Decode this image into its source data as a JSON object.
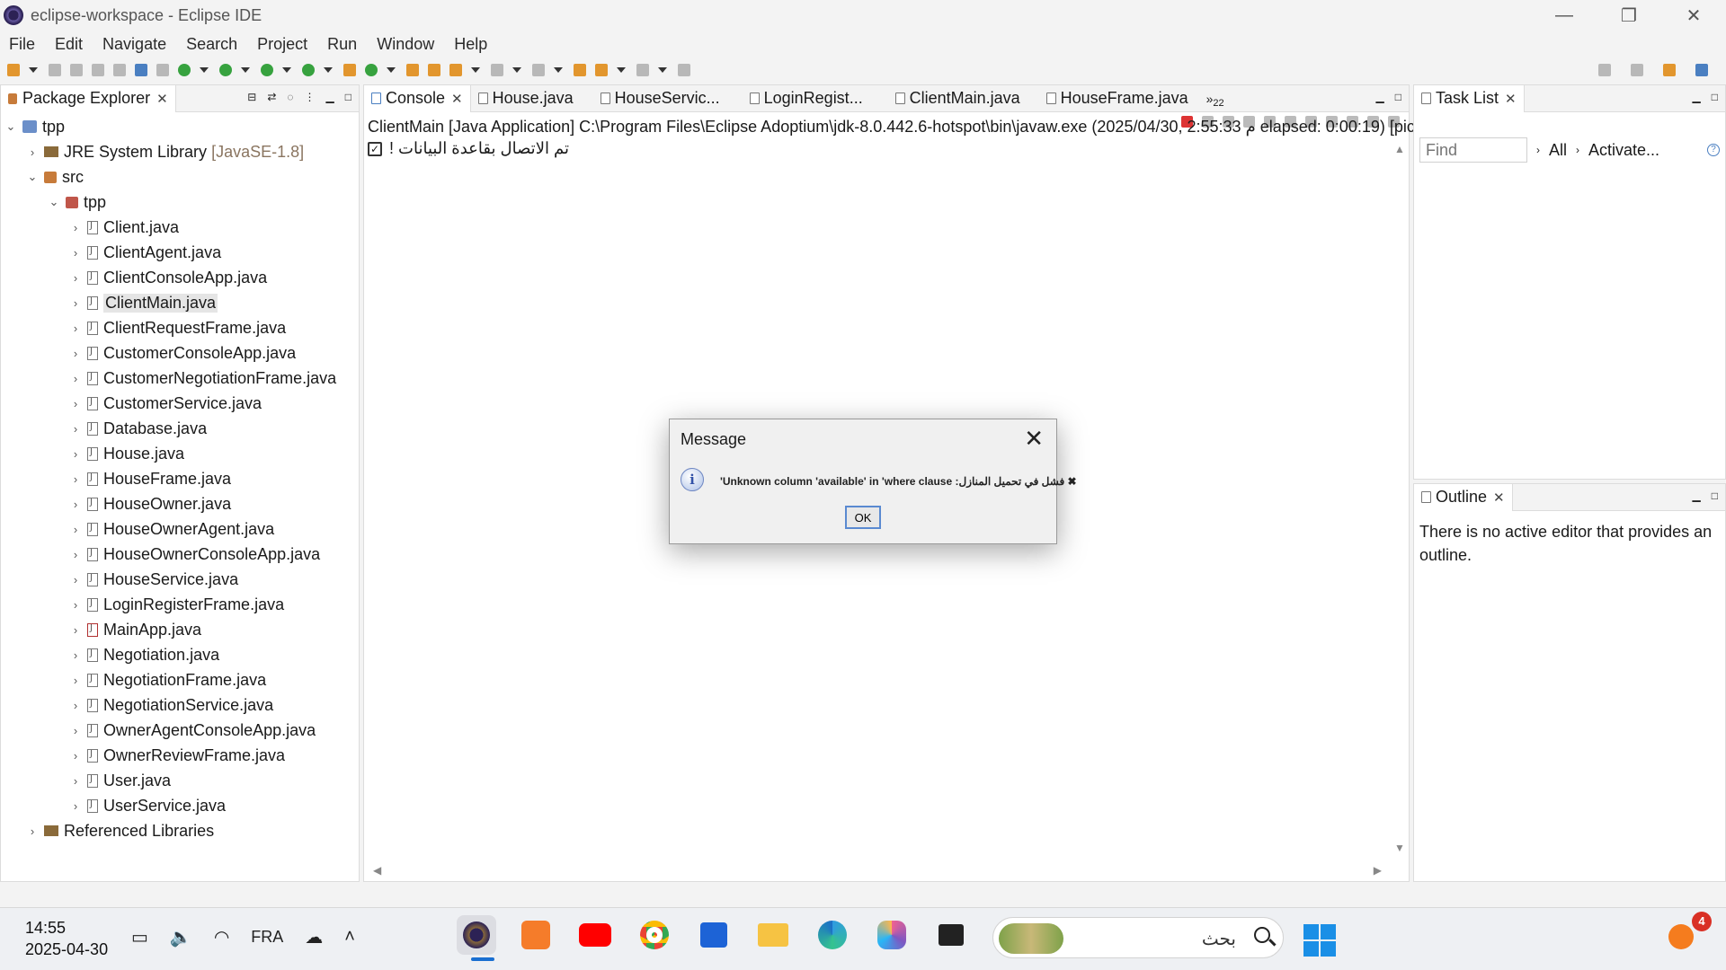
{
  "window": {
    "title": "eclipse-workspace - Eclipse IDE",
    "controls": [
      "—",
      "❐",
      "✕"
    ]
  },
  "menu": [
    "File",
    "Edit",
    "Navigate",
    "Search",
    "Project",
    "Run",
    "Window",
    "Help"
  ],
  "package_explorer": {
    "tab_label": "Package Explorer",
    "project": "tpp",
    "jre": "JRE System Library",
    "jre_version": "[JavaSE-1.8]",
    "src": "src",
    "package": "tpp",
    "files": [
      "Client.java",
      "ClientAgent.java",
      "ClientConsoleApp.java",
      "ClientMain.java",
      "ClientRequestFrame.java",
      "CustomerConsoleApp.java",
      "CustomerNegotiationFrame.java",
      "CustomerService.java",
      "Database.java",
      "House.java",
      "HouseFrame.java",
      "HouseOwner.java",
      "HouseOwnerAgent.java",
      "HouseOwnerConsoleApp.java",
      "HouseService.java",
      "LoginRegisterFrame.java",
      "MainApp.java",
      "Negotiation.java",
      "NegotiationFrame.java",
      "NegotiationService.java",
      "OwnerAgentConsoleApp.java",
      "OwnerReviewFrame.java",
      "User.java",
      "UserService.java"
    ],
    "selected_file": "ClientMain.java",
    "referenced_libraries": "Referenced Libraries"
  },
  "editor_tabs": {
    "console": "Console",
    "tabs": [
      "House.java",
      "HouseServic...",
      "LoginRegist...",
      "ClientMain.java",
      "HouseFrame.java"
    ],
    "overflow": "»",
    "overflow_count": "22"
  },
  "console": {
    "process_line": "ClientMain [Java Application] C:\\Program Files\\Eclipse Adoptium\\jdk-8.0.442.6-hotspot\\bin\\javaw.exe  (م 2:55:33 ,2025/04/30 elapsed: 0:00:19) [pic",
    "output_line": "! تم الاتصال بقاعدة البيانات"
  },
  "task_list": {
    "tab_label": "Task List",
    "find_placeholder": "Find",
    "all_label": "All",
    "activate_label": "Activate...",
    "help": "?"
  },
  "outline": {
    "tab_label": "Outline",
    "message": "There is no active editor that provides an outline."
  },
  "dialog": {
    "title": "Message",
    "info_glyph": "i",
    "message": "'Unknown column 'available' in 'where clause :فشل في تحميل المنازل ✖",
    "ok": "OK"
  },
  "taskbar": {
    "time": "14:55",
    "date": "2025-04-30",
    "language": "FRA",
    "search_text": "بحث",
    "notification_count": "4"
  },
  "icons": {
    "app_logo": "eclipse-icon",
    "info": "info-icon",
    "search": "search-icon",
    "start": "windows-start-icon"
  },
  "colors": {
    "accent": "#1a6fd1",
    "chrome_bg": "#f3f3f3",
    "selection": "#e5e5e5",
    "stop_red": "#d33333"
  }
}
